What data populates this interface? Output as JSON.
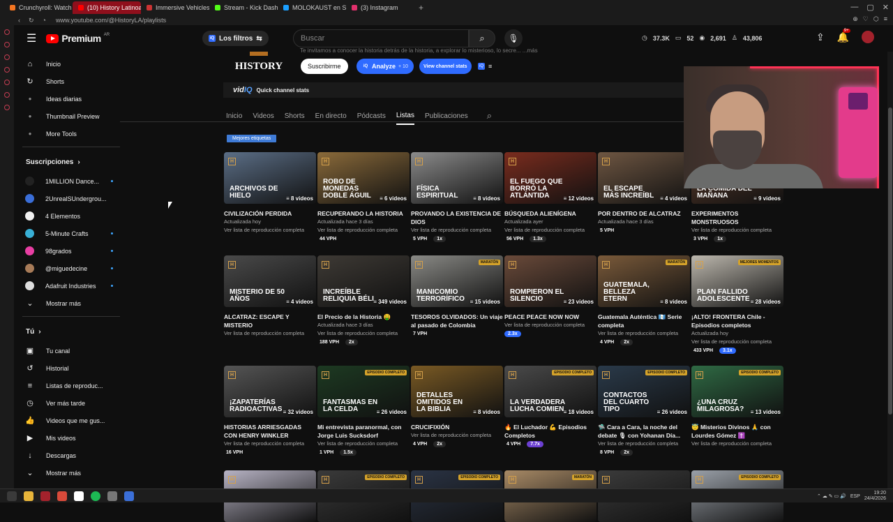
{
  "browser": {
    "tabs": [
      {
        "label": "Crunchyroll: Watch Popula...",
        "color": "#f47521"
      },
      {
        "label": "(10) History Latinoaméric...",
        "color": "#ff0000",
        "active": true
      },
      {
        "label": "Immersive Vehicles (MTS...",
        "color": "#cc3333"
      },
      {
        "label": "Stream - Kick Dashboard",
        "color": "#53fc18"
      },
      {
        "label": "MOLOKAUST en Steam",
        "color": "#1b9fff"
      },
      {
        "label": "(3) Instagram",
        "color": "#e1306c"
      }
    ],
    "new_tab": "+",
    "url": "www.youtube.com/@HistoryLA/playlists"
  },
  "header": {
    "logo": "Premium",
    "logo_country": "AR",
    "filters_label": "Los filtros",
    "search_placeholder": "Buscar",
    "stats": {
      "views": "37.3K",
      "videos": "52",
      "watching": "2,691",
      "subs": "43,806"
    },
    "notif_count": "9+"
  },
  "sidebar": {
    "main": [
      {
        "label": "Inicio",
        "icon": "home-icon",
        "glyph": "⌂"
      },
      {
        "label": "Shorts",
        "icon": "shorts-icon",
        "glyph": "↻"
      },
      {
        "label": "Ideas diarias",
        "icon": "idea-icon",
        "glyph": "●"
      },
      {
        "label": "Thumbnail Preview",
        "icon": "thumbnail-icon",
        "glyph": "●"
      },
      {
        "label": "More Tools",
        "icon": "tools-icon",
        "glyph": "●"
      }
    ],
    "subs_title": "Suscripciones",
    "subs": [
      {
        "label": "1MILLION Dance...",
        "color": "#222",
        "live": true
      },
      {
        "label": "2UnrealSUndergrou...",
        "color": "#3a6ed8",
        "live": false
      },
      {
        "label": "4 Elementos",
        "color": "#f0f0f0",
        "live": false
      },
      {
        "label": "5-Minute Crafts",
        "color": "#39b0d6",
        "live": true
      },
      {
        "label": "98grados",
        "color": "#e83ea3",
        "live": true
      },
      {
        "label": "@miguedecine",
        "color": "#a77b58",
        "live": true
      },
      {
        "label": "Adafruit Industries",
        "color": "#dddddd",
        "live": true
      }
    ],
    "show_more": "Mostrar más",
    "you_title": "Tú",
    "you": [
      {
        "label": "Tu canal",
        "glyph": "▣"
      },
      {
        "label": "Historial",
        "glyph": "↺"
      },
      {
        "label": "Listas de reproduc...",
        "glyph": "≡"
      },
      {
        "label": "Ver más tarde",
        "glyph": "◷"
      },
      {
        "label": "Videos que me gus...",
        "glyph": "👍"
      },
      {
        "label": "Mis videos",
        "glyph": "▶"
      },
      {
        "label": "Descargas",
        "glyph": "↓"
      }
    ],
    "show_more_2": "Mostrar más"
  },
  "channel": {
    "description": "Te invitamos a conocer la historia detrás de la historia, a explorar lo misterioso, lo secre...    ...más",
    "name_logo": "HISTORY",
    "subscribe": "Suscribirme",
    "analyze": "Analyze",
    "analyze_credits": "+ 10",
    "view_stats": "View channel stats",
    "quick_stats": "Quick channel stats",
    "tabs": [
      "Inicio",
      "Videos",
      "Shorts",
      "En directo",
      "Pódcasts",
      "Listas",
      "Publicaciones"
    ],
    "active_tab": "Listas",
    "chip": "Mejores etiquetas"
  },
  "playlists": [
    [
      {
        "thumb": "ARCHIVOS DE HIELO",
        "count": "8 videos",
        "title": "CIVILIZACIÓN PERDIDA",
        "updated": "Actualizada hoy",
        "link": "Ver lista de reproducción completa",
        "vph": "",
        "mult": "",
        "bg": "#5b6e86",
        "badge": ""
      },
      {
        "thumb": "ROBO DE MONEDAS DOBLE ÁGUIL",
        "count": "6 videos",
        "title": "RECUPERANDO LA HISTORIA",
        "updated": "Actualizada hace 3 días",
        "link": "Ver lista de reproducción completa",
        "vph": "44 VPH",
        "mult": "",
        "bg": "#8a6a3a",
        "badge": ""
      },
      {
        "thumb": "FÍSICA ESPIRITUAL",
        "count": "8 videos",
        "title": "PROVANDO LA EXISTENCIA DE DIOS",
        "updated": "",
        "link": "Ver lista de reproducción completa",
        "vph": "5 VPH",
        "mult": "1x",
        "bg": "#8b8b8b",
        "badge": ""
      },
      {
        "thumb": "EL FUEGO QUE BORRÓ LA ATLÁNTIDA",
        "count": "12 videos",
        "title": "BÚSQUEDA ALIENÍGENA",
        "updated": "Actualizada ayer",
        "link": "Ver lista de reproducción completa",
        "vph": "56 VPH",
        "mult": "1.3x",
        "bg": "#7a2c1e",
        "badge": ""
      },
      {
        "thumb": "EL ESCAPE MÁS INCREÍBL",
        "count": "4 videos",
        "title": "POR DENTRO DE ALCATRAZ",
        "updated": "Actualizada hace 3 días",
        "link": "",
        "vph": "5 VPH",
        "mult": "",
        "bg": "#6e5642",
        "badge": ""
      },
      {
        "thumb": "LA COMIDA DEL MAÑANA",
        "count": "9 videos",
        "title": "EXPERIMENTOS MONSTRUOSOS",
        "updated": "",
        "link": "Ver lista de reproducción completa",
        "vph": "3 VPH",
        "mult": "1x",
        "bg": "#5a3a2a",
        "badge": ""
      }
    ],
    [
      {
        "thumb": "MISTERIO DE 50 AÑOS",
        "count": "4 videos",
        "title": "ALCATRAZ: ESCAPE Y MISTERIO",
        "updated": "",
        "link": "Ver lista de reproducción completa",
        "vph": "",
        "mult": "",
        "bg": "#4a4a4a",
        "badge": ""
      },
      {
        "thumb": "INCREÍBLE RELIQUIA BÉLI",
        "count": "349 videos",
        "title": "El Precio de la Historia 🤑",
        "updated": "Actualizada hace 3 días",
        "link": "Ver lista de reproducción completa",
        "vph": "188 VPH",
        "mult": "2x",
        "bg": "#3e3a35",
        "badge": ""
      },
      {
        "thumb": "MANICOMIO TERRORÍFICO",
        "count": "15 videos",
        "title": "TESOROS OLVIDADOS: Un viaje al pasado de Colombia",
        "updated": "",
        "link": "",
        "vph": "7 VPH",
        "mult": "",
        "bg": "#8a8a86",
        "badge": "MARATÓN"
      },
      {
        "thumb": "ROMPIERON EL SILENCIO",
        "count": "23 videos",
        "title": "PEACE PEACE NOW NOW",
        "updated": "Ver lista de reproducción completa",
        "link": "",
        "vph": "",
        "mult": "2.3x",
        "bg": "#6a4a3a",
        "badge": ""
      },
      {
        "thumb": "GUATEMALA, BELLEZA ETERN",
        "count": "8 videos",
        "title": "Guatemala Auténtica 🇬🇹 Serie completa",
        "updated": "Ver lista de reproducción completa",
        "link": "",
        "vph": "4 VPH",
        "mult": "2x",
        "bg": "#7a5a3a",
        "badge": "MARATÓN"
      },
      {
        "thumb": "PLAN FALLIDO ADOLESCENTE",
        "count": "28 videos",
        "title": "¡ALTO! FRONTERA Chile - Episodios completos",
        "updated": "Actualizada hoy",
        "link": "Ver lista de reproducción completa",
        "vph": "433 VPH",
        "mult": "3.1x",
        "bg": "#bdb8ae",
        "badge": "MEJORES MOMENTOS"
      }
    ],
    [
      {
        "thumb": "¡ZAPATERÍAS RADIOACTIVAS",
        "count": "32 videos",
        "title": "HISTORIAS ARRIESGADAS CON HENRY WINKLER",
        "updated": "",
        "link": "Ver lista de reproducción completa",
        "vph": "16 VPH",
        "mult": "",
        "bg": "#555",
        "badge": ""
      },
      {
        "thumb": "FANTASMAS EN LA CELDA",
        "count": "26 videos",
        "title": "Mi entrevista paranormal, con Jorge Luis Sucksdorf",
        "updated": "",
        "link": "Ver lista de reproducción completa",
        "vph": "1 VPH",
        "mult": "1.5x",
        "bg": "#1d3a22",
        "badge": "EPISODIO COMPLETO"
      },
      {
        "thumb": "DETALLES OMITIDOS EN LA BIBLIA",
        "count": "8 videos",
        "title": "CRUCIFIXIÓN",
        "updated": "Ver lista de reproducción completa",
        "link": "",
        "vph": "4 VPH",
        "mult": "2x",
        "bg": "#7a5a24",
        "badge": ""
      },
      {
        "thumb": "LA VERDADERA LUCHA COMIEN",
        "count": "18 videos",
        "title": "🔥 El Luchador 💪 Episodios Completos",
        "updated": "",
        "link": "",
        "vph": "4 VPH",
        "mult": "7.7x",
        "bg": "#4a4a4a",
        "badge": "EPISODIO COMPLETO"
      },
      {
        "thumb": "CONTACTOS DEL CUARTO TIPO",
        "count": "26 videos",
        "title": "🛸 Cara a Cara, la noche del debate 🎙 con Yohanan Día...",
        "updated": "Ver lista de reproducción completa",
        "link": "",
        "vph": "8 VPH",
        "mult": "2x",
        "bg": "#2a3a4a",
        "badge": "EPISODIO COMPLETO"
      },
      {
        "thumb": "¿UNA CRUZ MILAGROSA?",
        "count": "13 videos",
        "title": "😇 Misterios Divinos 🙏 con Lourdes Gómez ✝️",
        "updated": "Ver lista de reproducción completa",
        "link": "",
        "vph": "",
        "mult": "",
        "bg": "#2f6a44",
        "badge": "EPISODIO COMPLETO"
      }
    ],
    [
      {
        "bg": "#b7b3c4",
        "badge": ""
      },
      {
        "bg": "#3a3a3a",
        "badge": "EPISODIO COMPLETO"
      },
      {
        "bg": "#2a3344",
        "badge": "EPISODIO COMPLETO"
      },
      {
        "bg": "#a88a66",
        "badge": "MARATÓN"
      },
      {
        "bg": "#3b3b3b",
        "badge": ""
      },
      {
        "bg": "#9aa0a8",
        "badge": "EPISODIO COMPLETO"
      }
    ]
  ],
  "mult_colors": {
    "1x": "#272727",
    "1.3x": "#272727",
    "2x": "#272727",
    "1.5x": "#272727",
    "2.3x": "#2f6bff",
    "3.1x": "#2f6bff",
    "7.7x": "#6b3fd1"
  },
  "taskbar": {
    "lang": "ESP",
    "time": "19:20",
    "date": "24/4/2026"
  }
}
